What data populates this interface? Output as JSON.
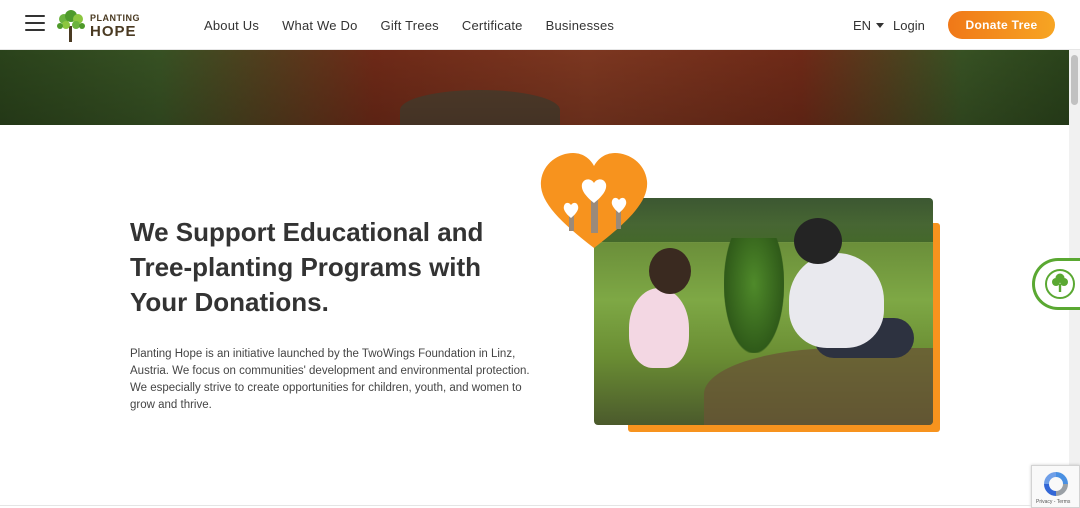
{
  "header": {
    "logo": {
      "top": "PLANTING",
      "bottom": "HOPE"
    },
    "nav": [
      "About Us",
      "What We Do",
      "Gift Trees",
      "Certificate",
      "Businesses"
    ],
    "language": "EN",
    "login": "Login",
    "donate": "Donate Tree"
  },
  "main": {
    "headline": "We Support Educational and Tree-planting Programs with Your Donations.",
    "body": "Planting Hope is an initiative launched by the TwoWings Foundation in Linz, Austria. We focus on communities' development and environmental protection. We especially strive to create opportunities for children, youth, and women to grow and thrive."
  },
  "recaptcha": {
    "footer": "Privacy - Terms"
  },
  "colors": {
    "accent": "#f7931e",
    "green": "#5aa832",
    "text": "#333333"
  },
  "icons": [
    "menu-icon",
    "logo-tree-icon",
    "chevron-down-icon",
    "heart-badge-icon",
    "tree-icon",
    "recaptcha-icon"
  ]
}
